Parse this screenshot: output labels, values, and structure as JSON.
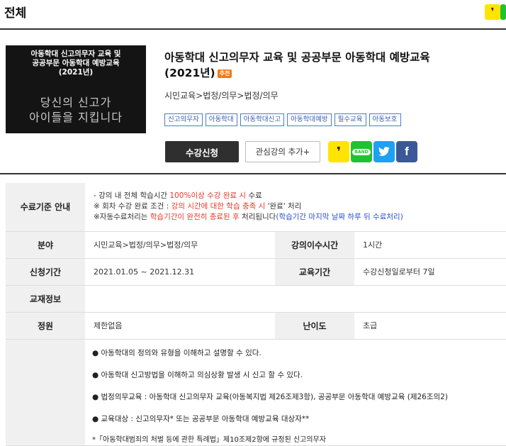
{
  "page": {
    "title": "전체"
  },
  "thumb": {
    "line1": "아동학대 신고의무자 교육 및",
    "line2": "공공부문 아동학대 예방교육",
    "line3": "(2021년)",
    "slogan1": "당신의 신고가",
    "slogan2": "아이들을 지킵니다"
  },
  "course": {
    "title_line1": "아동학대 신고의무자 교육 및 공공부문 아동학대 예방교육",
    "title_line2": "(2021년)",
    "badge": "추천",
    "category": "시민교육>법정/의무>법정/의무",
    "tags": [
      "신고의무자",
      "아동학대",
      "아동학대신고",
      "아동학대예방",
      "필수교육",
      "아동보호"
    ],
    "apply_label": "수강신청",
    "fav_label": "관심강의 추가+",
    "share": {
      "band": "BAND"
    }
  },
  "table": {
    "criteria_label": "수료기준 안내",
    "criteria_line1_a": "- 강의 내 전체 학습시간 ",
    "criteria_line1_red": "100%이상 수강 완료 시",
    "criteria_line1_b": " 수료",
    "criteria_line2_a": "※ 회차 수강 완료 조건 : ",
    "criteria_line2_red": "강의 시간에 대한 학습 충족 시",
    "criteria_line2_b": " '완료' 처리",
    "criteria_line3_a": "※자동수료처리는 ",
    "criteria_line3_red": "학습기간이 완전히 종료된 후",
    "criteria_line3_b": " 처리됩니다",
    "criteria_line3_blue": "(학습기간 마지막 날짜 하루 뒤 수료처리)",
    "field_label": "분야",
    "field_value": "시민교육>법정/의무>법정/의무",
    "duration_label": "강의이수시간",
    "duration_value": "1시간",
    "period_label": "신청기간",
    "period_value": "2021.01.05 ~ 2021.12.31",
    "edu_period_label": "교육기간",
    "edu_period_value": "수강신청일로부터 7일",
    "material_label": "교재정보",
    "material_value": "",
    "capacity_label": "정원",
    "capacity_value": "제한없음",
    "level_label": "난이도",
    "level_value": "초급"
  },
  "description": [
    "● 아동학대의 정의와 유형을 이해하고 설명할 수 있다.",
    "● 아동학대 신고방법을 이해하고 의심상황 발생 시 신고 할 수 있다.",
    "● 법정의무교육 : 아동학대 신고의무자 교육(아동복지법 제26조제3항), 공공부문 아동학대 예방교육 (제26조의2)",
    "● 교육대상 : 신고의무자* 또는 공공부문 아동학대 예방교육 대상자**",
    "*「아동학대범죄의 처벌 등에 관한 특례법」제10조제2항에 규정된 신고의무자"
  ],
  "colors": {
    "accent_red": "#e53a2b",
    "link_blue": "#2a52c9",
    "kakao_yellow": "#fee500",
    "band_green": "#1fc32f",
    "twitter": "#1da1f2",
    "facebook": "#3b5998"
  }
}
